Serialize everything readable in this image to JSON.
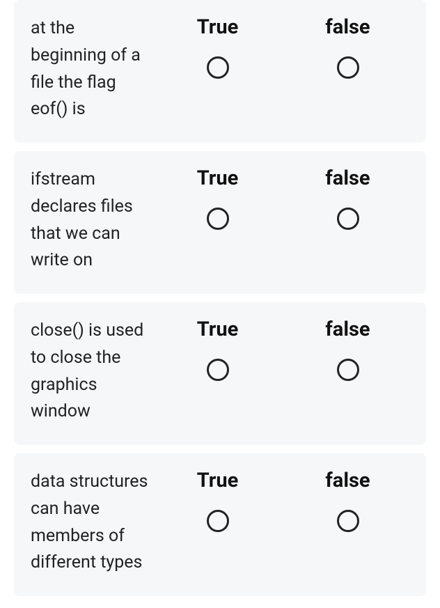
{
  "questions": [
    {
      "text": "at the beginning of a file the flag eof() is",
      "options": [
        {
          "label": "True"
        },
        {
          "label": "false"
        }
      ]
    },
    {
      "text": "ifstream declares files that we can write on",
      "options": [
        {
          "label": "True"
        },
        {
          "label": "false"
        }
      ]
    },
    {
      "text": "close() is used to close the graphics window",
      "options": [
        {
          "label": "True"
        },
        {
          "label": "false"
        }
      ]
    },
    {
      "text": "data structures can have members of different types",
      "options": [
        {
          "label": "True"
        },
        {
          "label": "false"
        }
      ]
    }
  ]
}
